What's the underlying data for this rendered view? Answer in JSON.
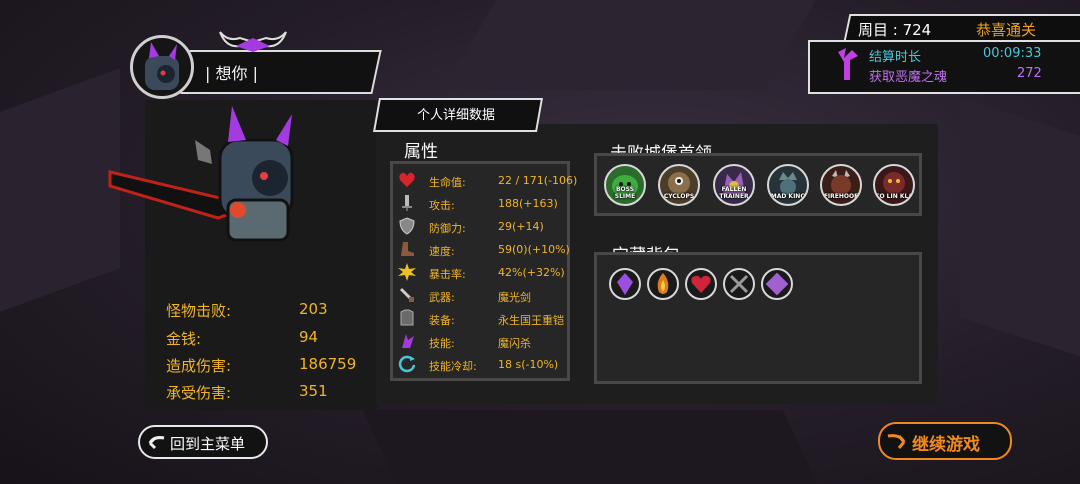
{
  "player": {
    "name": "| 想你 |"
  },
  "detail_tab": {
    "label": "个人详细数据"
  },
  "summary_stats": [
    {
      "label": "怪物击败:",
      "value": "203"
    },
    {
      "label": "金钱:",
      "value": "94"
    },
    {
      "label": "造成伤害:",
      "value": "186759"
    },
    {
      "label": "承受伤害:",
      "value": "351"
    }
  ],
  "attributes": {
    "title": "属性",
    "rows": [
      {
        "icon": "heart-icon",
        "label": "生命值:",
        "value": "22 / 171(-106)"
      },
      {
        "icon": "sword-icon",
        "label": "攻击:",
        "value": "188(+163)"
      },
      {
        "icon": "shield-icon",
        "label": "防御力:",
        "value": "29(+14)"
      },
      {
        "icon": "boot-icon",
        "label": "速度:",
        "value": "59(0)(+10%)"
      },
      {
        "icon": "crit-burst-icon",
        "label": "暴击率:",
        "value": "42%(+32%)"
      },
      {
        "icon": "weapon-icon",
        "label": "武器:",
        "value": "魔光剑"
      },
      {
        "icon": "armor-icon",
        "label": "装备:",
        "value": "永生国王重铠"
      },
      {
        "icon": "skill-icon",
        "label": "技能:",
        "value": "魔闪杀"
      },
      {
        "icon": "cooldown-icon",
        "label": "技能冷却:",
        "value": "18 s(-10%)"
      }
    ]
  },
  "bosses": {
    "title": "击败城堡首领",
    "items": [
      {
        "label": "BOSS SLIME",
        "color": "#3fae3f"
      },
      {
        "label": "CYCLOPS",
        "color": "#8a6f4a"
      },
      {
        "label": "FALLEN TRAINER",
        "color": "#9b5fb8"
      },
      {
        "label": "MAD KING",
        "color": "#4f6f7a"
      },
      {
        "label": "FIREHOOF",
        "color": "#7a3a2a"
      },
      {
        "label": "CO LIN KLA",
        "color": "#7a2a2a"
      }
    ]
  },
  "treasure": {
    "title": "宝藏背包",
    "items": [
      {
        "icon": "purple-crystal-icon",
        "color": "#9b4fe0"
      },
      {
        "icon": "fire-gem-icon",
        "color": "#e07a1a"
      },
      {
        "icon": "red-heart-gem-icon",
        "color": "#d0243a"
      },
      {
        "icon": "dark-rune-icon",
        "color": "#8a8a8a"
      },
      {
        "icon": "violet-rune-icon",
        "color": "#a060d0"
      }
    ]
  },
  "round": {
    "label": "周目 : 724",
    "status": "恭喜通关"
  },
  "settlement": {
    "time_label": "结算时长",
    "time_value": "00:09:33",
    "souls_label": "获取恶魔之魂",
    "souls_value": "272"
  },
  "buttons": {
    "back": "回到主菜单",
    "continue": "继续游戏"
  },
  "colors": {
    "gold": "#f0b429",
    "cyan": "#48c7d8",
    "purple": "#c070f0",
    "orange": "#f08a20"
  }
}
